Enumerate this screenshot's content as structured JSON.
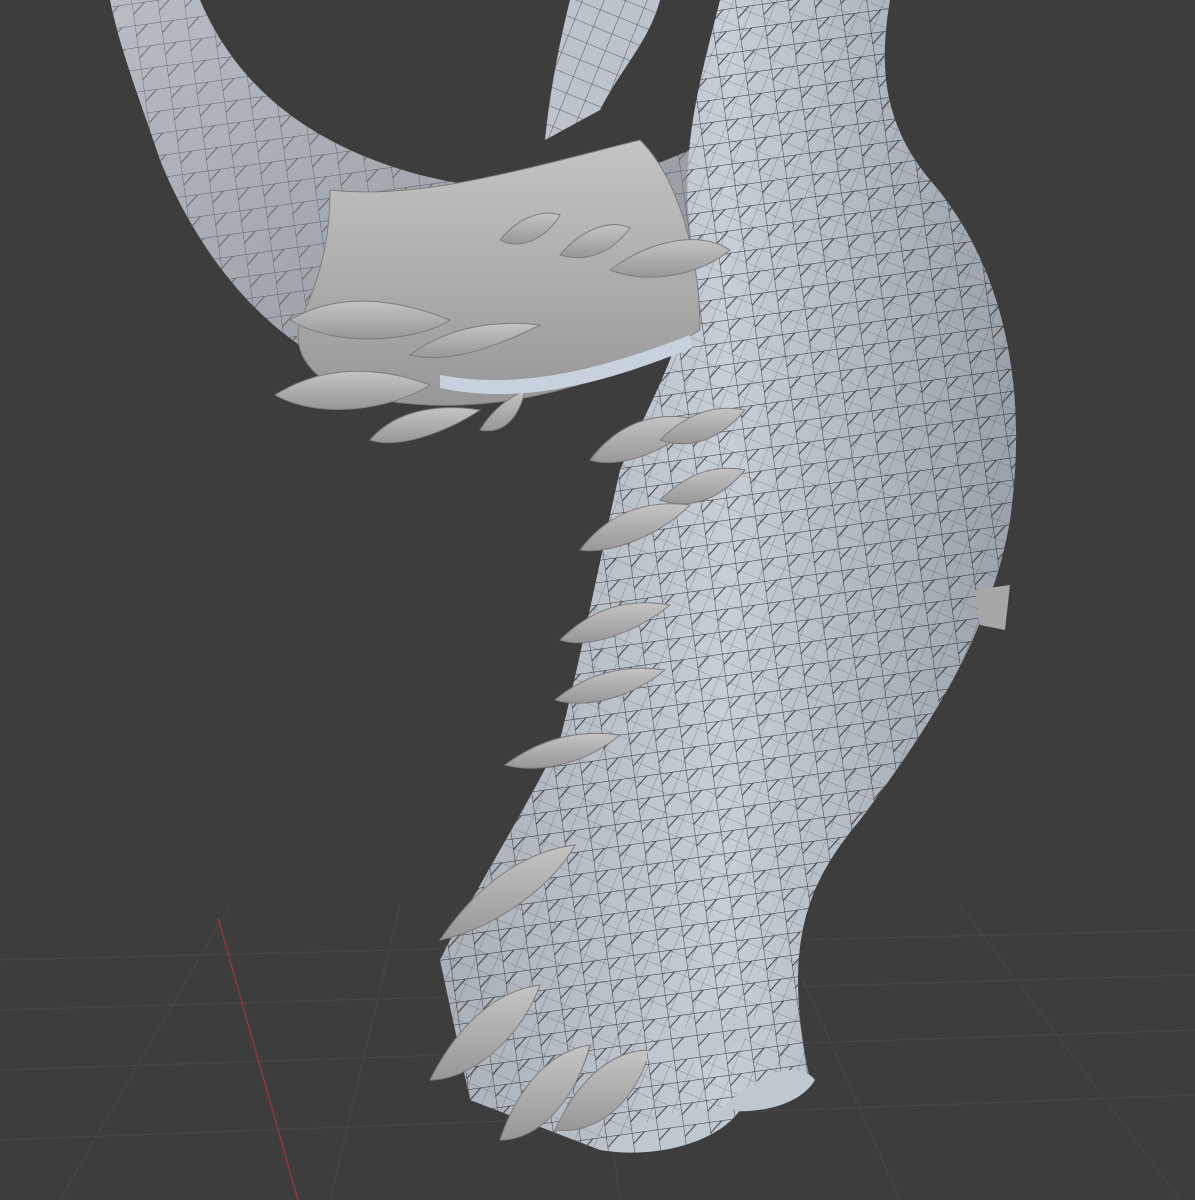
{
  "viewport": {
    "background_color": "#3d3d3d",
    "grid_color": "#484848",
    "x_axis_color": "#8a3a3a"
  },
  "model": {
    "shading": "solid",
    "overlay": "wireframe",
    "base_color": "#b9b9b9",
    "retopo_color": "#c3cbd3",
    "wire_color": "#1a1a1a"
  }
}
